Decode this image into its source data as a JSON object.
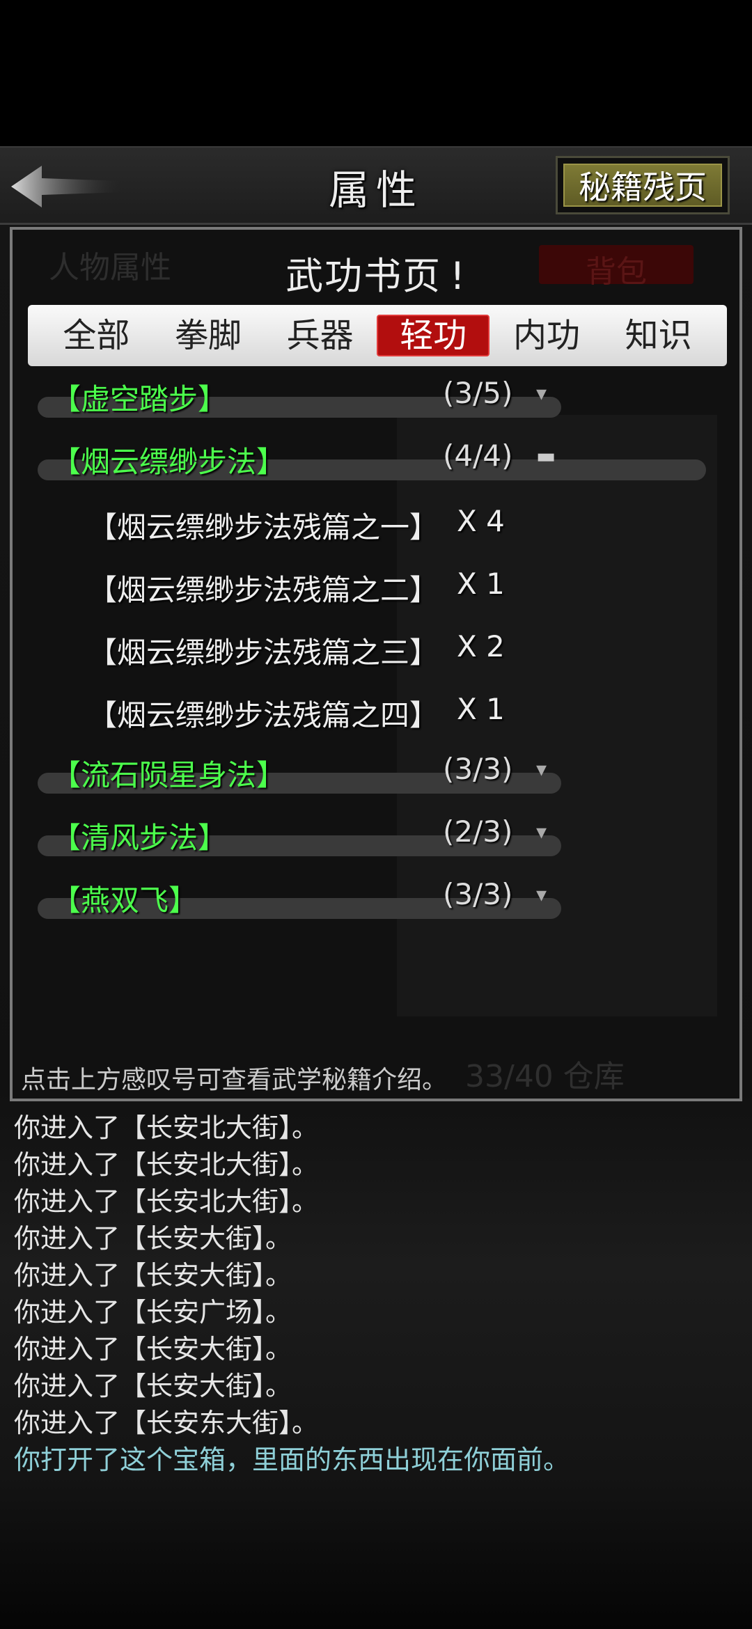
{
  "header": {
    "title": "属性",
    "fragment_button": "秘籍残页"
  },
  "background": {
    "tab_label": "人物属性",
    "bag_label": "背包",
    "footer": "33/40 仓库"
  },
  "overlay": {
    "title": "武功书页",
    "info_mark": "!",
    "tabs": [
      {
        "label": "全部",
        "active": false
      },
      {
        "label": "拳脚",
        "active": false
      },
      {
        "label": "兵器",
        "active": false
      },
      {
        "label": "轻功",
        "active": true
      },
      {
        "label": "内功",
        "active": false
      },
      {
        "label": "知识",
        "active": false
      }
    ],
    "skills": [
      {
        "name": "【虚空踏步】",
        "count": "(3/5)",
        "toggle": "▾"
      },
      {
        "name": "【烟云缥缈步法】",
        "count": "(4/4)",
        "toggle": "▬",
        "fragments": [
          {
            "name": "【烟云缥缈步法残篇之一】",
            "qty": "X 4"
          },
          {
            "name": "【烟云缥缈步法残篇之二】",
            "qty": "X 1"
          },
          {
            "name": "【烟云缥缈步法残篇之三】",
            "qty": "X 2"
          },
          {
            "name": "【烟云缥缈步法残篇之四】",
            "qty": "X 1"
          }
        ]
      },
      {
        "name": "【流石陨星身法】",
        "count": "(3/3)",
        "toggle": "▾"
      },
      {
        "name": "【清风步法】",
        "count": "(2/3)",
        "toggle": "▾"
      },
      {
        "name": "【燕双飞】",
        "count": "(3/3)",
        "toggle": "▾"
      }
    ],
    "hint": "点击上方感叹号可查看武学秘籍介绍。"
  },
  "log": [
    "你进入了【长安北大街】。",
    "你进入了【长安北大街】。",
    "你进入了【长安北大街】。",
    "你进入了【长安大街】。",
    "你进入了【长安大街】。",
    "你进入了【长安广场】。",
    "你进入了【长安大街】。",
    "你进入了【长安大街】。",
    "你进入了【长安东大街】。",
    "你打开了这个宝箱，里面的东西出现在你面前。"
  ],
  "colors": {
    "skill_name": "#4cff4c",
    "active_tab": "#b20e0e",
    "fragment_button": "#7e7a35",
    "last_log": "#8fd0d8"
  }
}
